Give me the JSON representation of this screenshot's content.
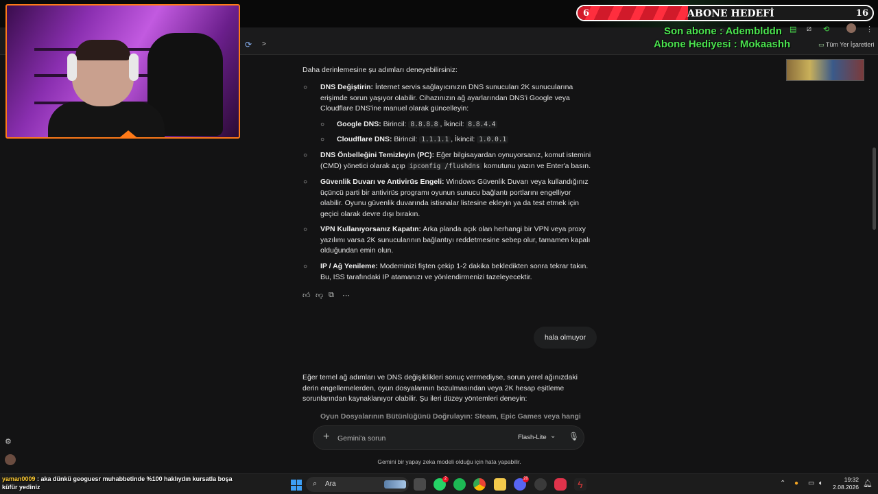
{
  "browser": {
    "bookmarks_label": "Tüm Yer İşaretleri"
  },
  "overlay": {
    "subscriber_bar": {
      "current": "6",
      "title": "ABONE HEDEFİ",
      "goal": "16",
      "progress_fraction": 0.375
    },
    "last_subscriber": "Son abone : Ademblddn",
    "sub_gift": "Abone Hediyesi : Mokaashh"
  },
  "conversation": {
    "intro": "Daha derinlemesine şu adımları deneyebilirsiniz:",
    "bullets": [
      {
        "title": "DNS Değiştirin:",
        "text": " İnternet servis sağlayıcınızın DNS sunucuları 2K sunucularına erişimde sorun yaşıyor olabilir. Cihazınızın ağ ayarlarından DNS'i Google veya Cloudflare DNS'ine manuel olarak güncelleyin:"
      },
      {
        "title": "DNS Önbelleğini Temizleyin (PC):",
        "text_a": " Eğer bilgisayardan oynuyorsanız, komut istemini (CMD) yönetici olarak açıp",
        "code": "ipconfig /flushdns",
        "text_b": " komutunu yazın ve Enter'a basın."
      },
      {
        "title": "Güvenlik Duvarı ve Antivirüs Engeli:",
        "text": " Windows Güvenlik Duvarı veya kullandığınız üçüncü parti bir antivirüs programı oyunun sunucu bağlantı portlarını engelliyor olabilir. Oyunu güvenlik duvarında istisnalar listesine ekleyin ya da test etmek için geçici olarak devre dışı bırakın."
      },
      {
        "title": "VPN Kullanıyorsanız Kapatın:",
        "text": " Arka planda açık olan herhangi bir VPN veya proxy yazılımı varsa 2K sunucularının bağlantıyı reddetmesine sebep olur, tamamen kapalı olduğundan emin olun."
      },
      {
        "title": "IP / Ağ Yenileme:",
        "text": " Modeminizi fişten çekip 1-2 dakika bekledikten sonra tekrar takın. Bu, ISS tarafındaki IP atamanızı ve yönlendirmenizi tazeleyecektir."
      }
    ],
    "dns_items": [
      {
        "name": "Google DNS:",
        "primary_label": " Birincil:",
        "primary": "8.8.8.8",
        "secondary_label": ", İkincil:",
        "secondary": "8.8.4.4"
      },
      {
        "name": "Cloudflare DNS:",
        "primary_label": " Birincil:",
        "primary": "1.1.1.1",
        "secondary_label": ", İkincil:",
        "secondary": "1.0.0.1"
      }
    ],
    "user_message": "hala olmuyor",
    "reply_intro": "Eğer temel ağ adımları ve DNS değişiklikleri sonuç vermediyse, sorun yerel ağınızdaki derin engellemelerden, oyun dosyalarının bozulmasından veya 2K hesap eşitleme sorunlarından kaynaklanıyor olabilir. Şu ileri düzey yöntemleri deneyin:",
    "reply_bullet": "Oyun Dosyalarının Bütünlüğünü Doğrulayın: Steam, Epic Games veya hangi platformu"
  },
  "composer": {
    "placeholder": "Gemini'a sorun",
    "model": "Flash-Lite",
    "disclaimer": "Gemini bir yapay zeka modeli olduğu için hata yapabilir."
  },
  "chat_overlay": {
    "user": "yaman0009",
    "message": " : aka dünkü geoguesr muhabbetinde %100 haklıydın kursatla boşa küfür yediniz"
  },
  "taskbar": {
    "search_label": "Ara",
    "time": "19:32",
    "date": "2.08.2026",
    "whatsapp_badge": "2",
    "discord_badge": "20"
  },
  "icons": {
    "search": "search-icon",
    "plus": "plus-icon",
    "mic": "mic-icon",
    "like": "thumbs-up-icon",
    "dislike": "thumbs-down-icon",
    "copy": "copy-icon",
    "more": "more-icon"
  },
  "colors": {
    "accent_green": "#4be24f",
    "sub_bar_red": "#d11a2a",
    "webcam_border": "#ff7a18",
    "background": "#131314"
  }
}
